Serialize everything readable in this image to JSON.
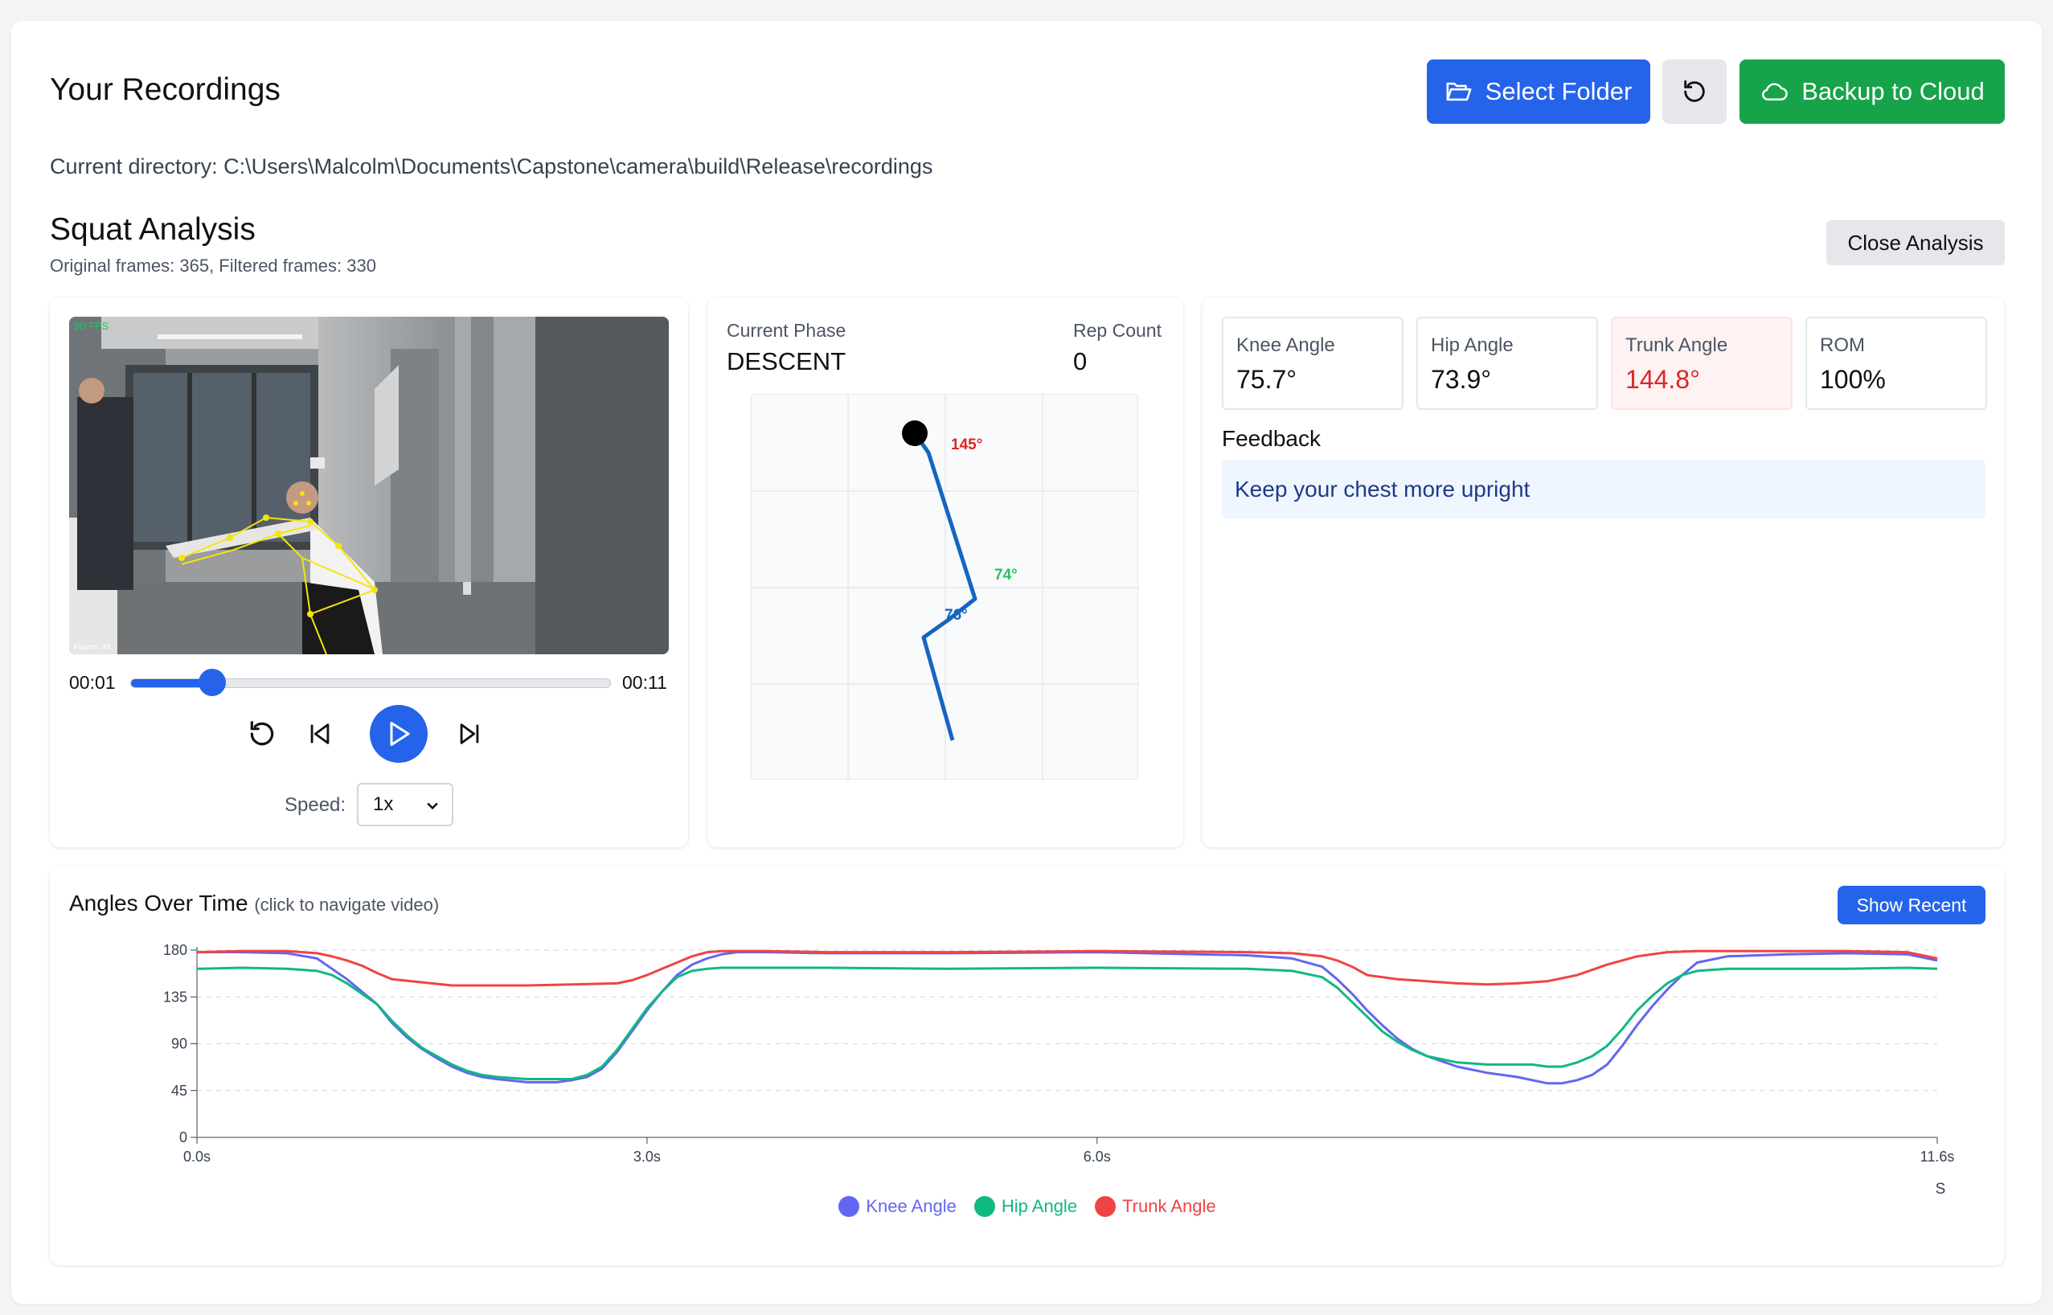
{
  "header": {
    "title": "Your Recordings",
    "select_folder_label": "Select Folder",
    "backup_label": "Backup to Cloud",
    "current_directory": "Current directory: C:\\Users\\Malcolm\\Documents\\Capstone\\camera\\build\\Release\\recordings"
  },
  "analysis": {
    "title": "Squat Analysis",
    "frames_info": "Original frames: 365, Filtered frames: 330",
    "close_label": "Close Analysis"
  },
  "video": {
    "current_time": "00:01",
    "duration": "00:11",
    "progress_fraction": 0.17,
    "speed_label": "Speed:",
    "speed_value": "1x",
    "overlay_fps": "30 FPS",
    "overlay_frame": "Frame: 49"
  },
  "skeleton": {
    "phase_label": "Current Phase",
    "phase_value": "DESCENT",
    "rep_label": "Rep Count",
    "rep_value": "0",
    "trunk_label": "145°",
    "hip_label": "74°",
    "knee_label": "76°",
    "colors": {
      "bone": "#1565c0",
      "trunk": "#dc2626",
      "hip": "#22c55e"
    }
  },
  "metrics": [
    {
      "label": "Knee Angle",
      "value": "75.7°",
      "warn": false
    },
    {
      "label": "Hip Angle",
      "value": "73.9°",
      "warn": false
    },
    {
      "label": "Trunk Angle",
      "value": "144.8°",
      "warn": true
    },
    {
      "label": "ROM",
      "value": "100%",
      "warn": false
    }
  ],
  "feedback": {
    "title": "Feedback",
    "message": "Keep your chest more upright"
  },
  "chart": {
    "title": "Angles Over Time",
    "hint": "(click to navigate video)",
    "show_recent_label": "Show Recent"
  },
  "chart_data": {
    "type": "line",
    "x_unit": "s",
    "xlim": [
      0,
      11.6
    ],
    "ylim": [
      0,
      180
    ],
    "x_ticks": [
      0,
      3,
      6,
      11.6
    ],
    "x_tick_labels": [
      "0.0s",
      "3.0s",
      "6.0s",
      "11.6s"
    ],
    "y_ticks": [
      0,
      45,
      90,
      135,
      180
    ],
    "xlabel": "S",
    "grid": "horizontal dashed",
    "legend_position": "bottom",
    "series": [
      {
        "name": "Knee Angle",
        "color": "#6366f1",
        "x": [
          0,
          0.3,
          0.6,
          0.8,
          0.9,
          1.0,
          1.1,
          1.2,
          1.3,
          1.4,
          1.5,
          1.6,
          1.7,
          1.8,
          1.9,
          2.0,
          2.2,
          2.4,
          2.5,
          2.6,
          2.7,
          2.8,
          2.9,
          3.0,
          3.1,
          3.2,
          3.3,
          3.4,
          3.5,
          3.6,
          3.8,
          4.2,
          5.0,
          6.0,
          7.0,
          7.3,
          7.5,
          7.6,
          7.7,
          7.8,
          7.9,
          8.0,
          8.1,
          8.2,
          8.4,
          8.6,
          8.8,
          8.9,
          9.0,
          9.1,
          9.2,
          9.3,
          9.4,
          9.5,
          9.6,
          9.7,
          9.8,
          9.9,
          10.0,
          10.2,
          10.6,
          11.0,
          11.4,
          11.6
        ],
        "y": [
          178,
          178,
          177,
          172,
          162,
          152,
          140,
          128,
          110,
          96,
          85,
          76,
          68,
          62,
          58,
          56,
          53,
          53,
          55,
          58,
          66,
          82,
          102,
          122,
          140,
          156,
          166,
          172,
          176,
          178,
          178,
          177,
          177,
          178,
          175,
          172,
          164,
          152,
          138,
          122,
          108,
          95,
          85,
          78,
          68,
          62,
          58,
          55,
          52,
          52,
          55,
          60,
          70,
          88,
          108,
          126,
          142,
          156,
          168,
          174,
          176,
          177,
          176,
          170
        ]
      },
      {
        "name": "Hip Angle",
        "color": "#10b981",
        "x": [
          0,
          0.3,
          0.6,
          0.8,
          0.9,
          1.0,
          1.1,
          1.2,
          1.3,
          1.4,
          1.5,
          1.6,
          1.7,
          1.8,
          1.9,
          2.0,
          2.2,
          2.4,
          2.5,
          2.6,
          2.7,
          2.8,
          2.9,
          3.0,
          3.1,
          3.2,
          3.3,
          3.4,
          3.5,
          3.6,
          3.8,
          4.2,
          5.0,
          6.0,
          7.0,
          7.3,
          7.5,
          7.6,
          7.7,
          7.8,
          7.9,
          8.0,
          8.1,
          8.2,
          8.4,
          8.6,
          8.8,
          8.9,
          9.0,
          9.1,
          9.2,
          9.3,
          9.4,
          9.5,
          9.6,
          9.7,
          9.8,
          9.9,
          10.0,
          10.2,
          10.6,
          11.0,
          11.4,
          11.6
        ],
        "y": [
          162,
          163,
          162,
          160,
          156,
          148,
          138,
          128,
          112,
          98,
          86,
          78,
          70,
          64,
          60,
          58,
          56,
          56,
          56,
          60,
          68,
          84,
          104,
          124,
          140,
          154,
          160,
          162,
          163,
          163,
          163,
          163,
          162,
          163,
          162,
          160,
          154,
          144,
          130,
          116,
          102,
          92,
          84,
          78,
          72,
          70,
          70,
          70,
          68,
          68,
          72,
          78,
          88,
          104,
          122,
          136,
          148,
          156,
          160,
          162,
          162,
          162,
          163,
          162
        ]
      },
      {
        "name": "Trunk Angle",
        "color": "#ef4444",
        "x": [
          0,
          0.3,
          0.6,
          0.8,
          0.9,
          1.0,
          1.1,
          1.2,
          1.3,
          1.5,
          1.7,
          1.9,
          2.2,
          2.5,
          2.8,
          2.9,
          3.0,
          3.1,
          3.2,
          3.3,
          3.4,
          3.5,
          3.6,
          3.8,
          4.2,
          5.0,
          6.0,
          7.0,
          7.3,
          7.5,
          7.6,
          7.7,
          7.8,
          8.0,
          8.2,
          8.4,
          8.6,
          8.8,
          9.0,
          9.2,
          9.4,
          9.6,
          9.8,
          10.0,
          10.2,
          10.6,
          11.0,
          11.4,
          11.6
        ],
        "y": [
          178,
          179,
          179,
          177,
          174,
          170,
          165,
          158,
          152,
          149,
          146,
          146,
          146,
          147,
          148,
          151,
          156,
          162,
          168,
          174,
          178,
          179,
          179,
          179,
          178,
          178,
          179,
          178,
          177,
          174,
          170,
          164,
          156,
          152,
          150,
          148,
          147,
          148,
          150,
          156,
          166,
          174,
          178,
          179,
          179,
          179,
          179,
          178,
          172
        ]
      }
    ]
  }
}
